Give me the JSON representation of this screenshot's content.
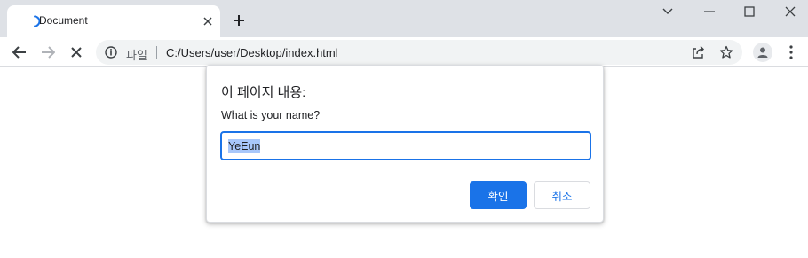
{
  "browser": {
    "tab": {
      "title": "Document",
      "favicon": "loading-spinner-icon"
    },
    "window_controls": [
      "chevron-down-icon",
      "minimize-icon",
      "maximize-icon",
      "close-icon"
    ],
    "address_bar": {
      "scheme_label": "파일",
      "url": "C:/Users/user/Desktop/index.html"
    }
  },
  "dialog": {
    "title": "이 페이지 내용:",
    "message": "What is your name?",
    "input_value": "YeEun",
    "ok_label": "확인",
    "cancel_label": "취소"
  },
  "colors": {
    "accent": "#1a73e8",
    "titlebar": "#dee1e6",
    "selection": "#a8c7fa"
  }
}
